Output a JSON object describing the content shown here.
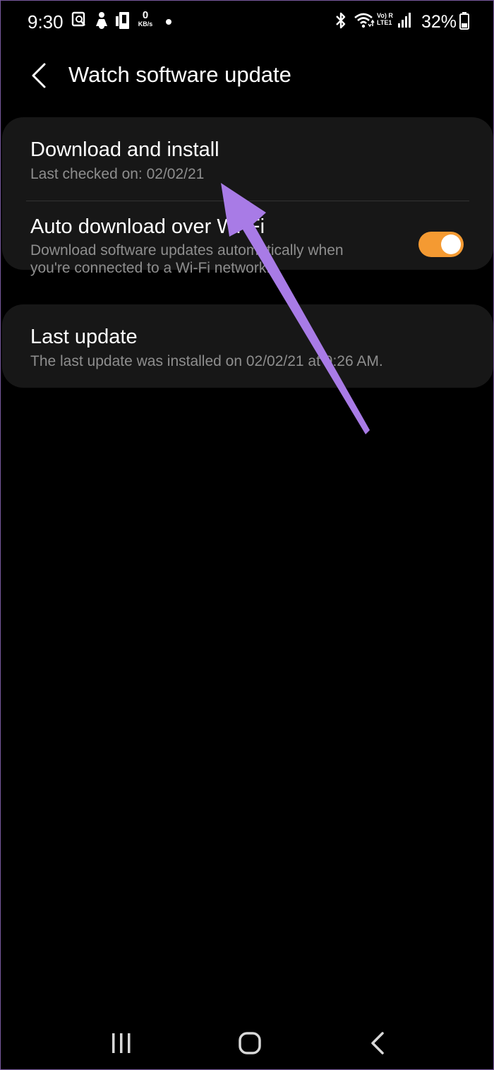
{
  "status_bar": {
    "time": "9:30",
    "data_speed": "0",
    "data_speed_unit": "KB/s",
    "network_label_1": "Vo) R",
    "network_label_2": "LTE1",
    "battery": "32%"
  },
  "header": {
    "title": "Watch software update",
    "back_icon": "back-chevron-icon"
  },
  "settings": {
    "download": {
      "title": "Download and install",
      "subtitle": "Last checked on: 02/02/21"
    },
    "auto_download": {
      "title": "Auto download over Wi-Fi",
      "subtitle": "Download software updates automatically when you're connected to a Wi-Fi network.",
      "enabled": true
    },
    "last_update": {
      "title": "Last update",
      "subtitle": "The last update was installed on 02/02/21 at 9:26 AM."
    }
  },
  "colors": {
    "background": "#000000",
    "card": "#171717",
    "toggle_on": "#f49a32",
    "annotation_arrow": "#a87be6",
    "secondary_text": "#8e8e8e"
  },
  "nav_bar": {
    "recents_icon": "recents-icon",
    "home_icon": "home-icon",
    "back_icon": "back-icon"
  }
}
